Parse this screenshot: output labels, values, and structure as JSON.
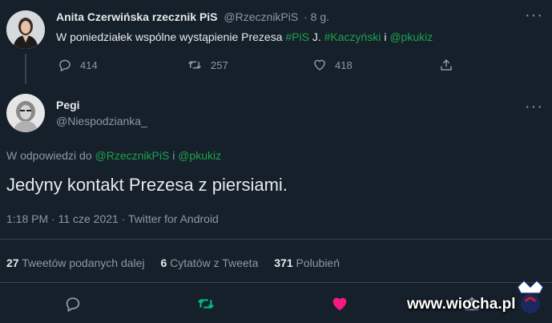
{
  "parent_tweet": {
    "author_name": "Anita Czerwińska rzecznik PiS",
    "handle": "@RzecznikPiS",
    "time": "· 8 g.",
    "text_before": "W poniedziałek wspólne wystąpienie Prezesa ",
    "tag_pis": "#PiS",
    "text_mid1": " J. ",
    "tag_kaczynski": "#Kaczyński",
    "text_mid2": " i ",
    "mention_pkukiz": "@pkukiz",
    "replies": "414",
    "retweets": "257",
    "likes": "418"
  },
  "reply_tweet": {
    "author_name": "Pegi",
    "handle": "@Niespodzianka_",
    "reply_to_prefix": "W odpowiedzi do ",
    "reply_to_user1": "@RzecznikPiS",
    "reply_to_join": " i ",
    "reply_to_user2": "@pkukiz",
    "text": "Jedyny kontakt Prezesa z piersiami.",
    "meta": "1:18 PM · 11 cze 2021 · Twitter for Android"
  },
  "stats": {
    "retweets_count": "27",
    "retweets_label": "Tweetów podanych dalej",
    "quotes_count": "6",
    "quotes_label": "Cytatów z Tweeta",
    "likes_count": "371",
    "likes_label": "Polubień"
  },
  "watermark": "www.wiocha.pl",
  "colors": {
    "background": "#15202b",
    "accent_green": "#1fa24a",
    "like_red": "#f91880",
    "muted": "#8b98a5",
    "retweet_green": "#00ba7c"
  },
  "icons": {
    "reply": "reply-icon",
    "retweet": "retweet-icon",
    "like": "heart-icon",
    "share": "share-icon",
    "more": "more-icon"
  }
}
